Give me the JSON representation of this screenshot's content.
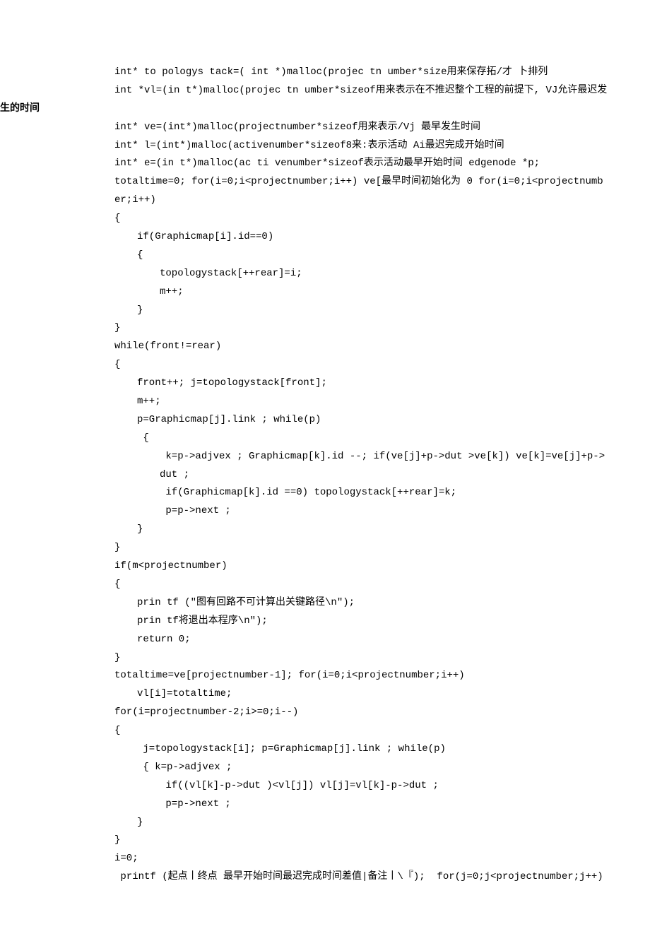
{
  "lines": [
    {
      "cls": "i1",
      "text": "int* to pologys tack=( int *)malloc(projec tn umber*size用来保存拓/才 卜排列"
    },
    {
      "cls": "i1",
      "text": "int *vl=(in t*)malloc(projec tn umber*sizeof用来表示在不推迟整个工程的前提下, VJ允许最迟发"
    },
    {
      "cls": "outdent bold",
      "text": "生的时间"
    },
    {
      "cls": "i1",
      "text": "int* ve=(int*)malloc(projectnumber*sizeof用来表示/Vj 最早发生时间"
    },
    {
      "cls": "i1",
      "text": "int* l=(int*)malloc(activenumber*sizeof8来:表示活动 Ai最迟完成开始时间"
    },
    {
      "cls": "i1",
      "text": "int* e=(in t*)malloc(ac ti venumber*sizeof表示活动最早开始时间 edgenode *p;"
    },
    {
      "cls": "i1",
      "text": "totaltime=0; for(i=0;i<projectnumber;i++) ve[最早时间初始化为 0 for(i=0;i<projectnumber;i++)"
    },
    {
      "cls": "i1",
      "text": "{"
    },
    {
      "cls": "i2",
      "text": "if(Graphicmap[i].id==0)"
    },
    {
      "cls": "i2",
      "text": "{"
    },
    {
      "cls": "i3",
      "text": "topologystack[++rear]=i;"
    },
    {
      "cls": "i3",
      "text": "m++;"
    },
    {
      "cls": "i2",
      "text": "}"
    },
    {
      "cls": "i1",
      "text": "}"
    },
    {
      "cls": "i1",
      "text": "while(front!=rear)"
    },
    {
      "cls": "i1",
      "text": "{"
    },
    {
      "cls": "i2",
      "text": "front++; j=topologystack[front];"
    },
    {
      "cls": "i2",
      "text": "m++;"
    },
    {
      "cls": "i2",
      "text": "p=Graphicmap[j].link ; while(p)"
    },
    {
      "cls": "i2",
      "text": " {"
    },
    {
      "cls": "i3",
      "text": " k=p->adjvex ; Graphicmap[k].id --; if(ve[j]+p->dut >ve[k]) ve[k]=ve[j]+p->dut ;"
    },
    {
      "cls": "i3",
      "text": " if(Graphicmap[k].id ==0) topologystack[++rear]=k;"
    },
    {
      "cls": "i3",
      "text": " p=p->next ;"
    },
    {
      "cls": "i2",
      "text": "}"
    },
    {
      "cls": "i1",
      "text": "}"
    },
    {
      "cls": "i1",
      "text": "if(m<projectnumber)"
    },
    {
      "cls": "i1",
      "text": "{"
    },
    {
      "cls": "i2",
      "text": "prin tf (\"图有回路不可计算出关键路径\\n\");"
    },
    {
      "cls": "i2",
      "text": "prin tf将退出本程序\\n\");"
    },
    {
      "cls": "i2",
      "text": "return 0;"
    },
    {
      "cls": "i1",
      "text": "}"
    },
    {
      "cls": "i1",
      "text": "totaltime=ve[projectnumber-1]; for(i=0;i<projectnumber;i++)"
    },
    {
      "cls": "i2",
      "text": "vl[i]=totaltime;"
    },
    {
      "cls": "i1",
      "text": "for(i=projectnumber-2;i>=0;i--)"
    },
    {
      "cls": "i1",
      "text": "{"
    },
    {
      "cls": "i2",
      "text": " j=topologystack[i]; p=Graphicmap[j].link ; while(p)"
    },
    {
      "cls": "i2",
      "text": " { k=p->adjvex ;"
    },
    {
      "cls": "i3",
      "text": " if((vl[k]-p->dut )<vl[j]) vl[j]=vl[k]-p->dut ;"
    },
    {
      "cls": "i3",
      "text": " p=p->next ;"
    },
    {
      "cls": "i2",
      "text": "}"
    },
    {
      "cls": "i1",
      "text": "}"
    },
    {
      "cls": "i1",
      "text": "i=0;"
    },
    {
      "cls": "i1",
      "text": " printf (起点丨终点 最早开始时间最迟完成时间差值|备注丨\\『);  for(j=0;j<projectnumber;j++)"
    }
  ]
}
